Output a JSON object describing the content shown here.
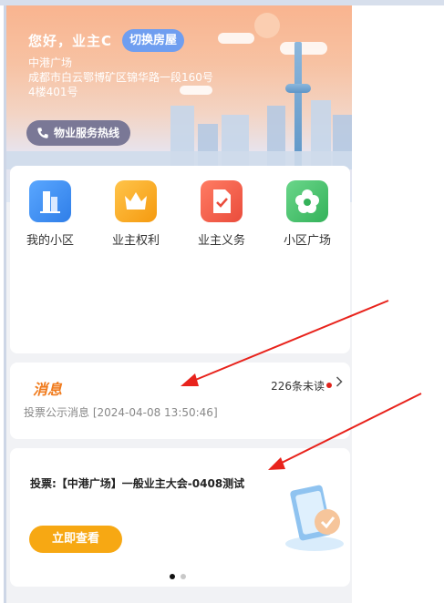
{
  "header": {
    "greeting": "您好，业主C",
    "switch_label": "切换房屋",
    "community": "中港广场",
    "address": "成都市白云鄂博矿区锦华路一段160号",
    "unit": "4楼401号",
    "hotline_label": "物业服务热线"
  },
  "functions": [
    {
      "label": "我的小区",
      "icon": "building-icon",
      "color": "#3d8ef0"
    },
    {
      "label": "业主权利",
      "icon": "crown-icon",
      "color": "#f7a81b"
    },
    {
      "label": "业主义务",
      "icon": "document-check-icon",
      "color": "#f2624f"
    },
    {
      "label": "小区广场",
      "icon": "flower-icon",
      "color": "#45c16c"
    }
  ],
  "messages": {
    "title": "消息",
    "unread": "226条未读",
    "latest": "投票公示消息 [2024-04-08 13:50:46]"
  },
  "vote": {
    "title": "投票:【中港广场】一般业主大会-0408测试",
    "button_label": "立即查看",
    "carousel_pages": 2,
    "carousel_active": 1
  },
  "colors": {
    "accent_orange": "#f07b1d",
    "button_orange": "#f7a813",
    "switch_blue": "#6f9ef0",
    "unread_dot": "#e0231b",
    "annotation_arrow": "#e8231c"
  }
}
